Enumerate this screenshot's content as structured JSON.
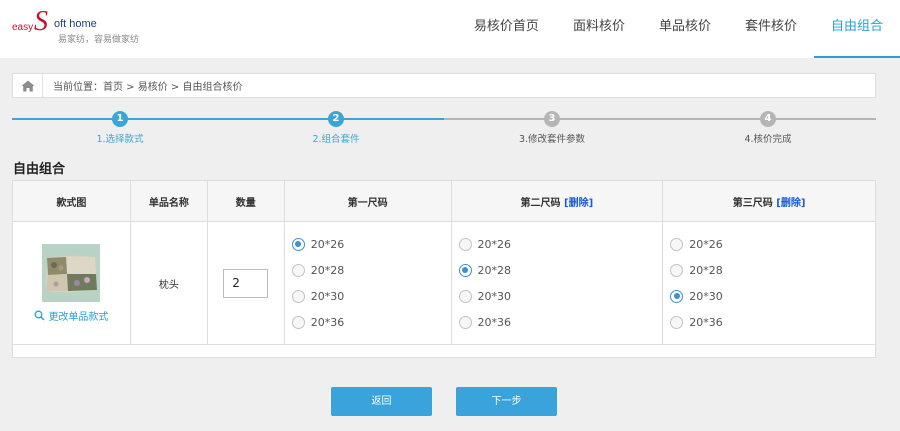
{
  "header": {
    "logo": {
      "easy": "easy",
      "s_letter": "S",
      "rest": "oft home",
      "slogan": "易家纺，容易做家纺"
    },
    "nav": [
      {
        "label": "易核价首页",
        "name": "nav-home"
      },
      {
        "label": "面料核价",
        "name": "nav-fabric-pricing"
      },
      {
        "label": "单品核价",
        "name": "nav-single-pricing"
      },
      {
        "label": "套件核价",
        "name": "nav-set-pricing"
      },
      {
        "label": "自由组合",
        "name": "nav-free-combination"
      }
    ],
    "active_nav": 4,
    "accent_color": "#2a9fd6"
  },
  "breadcrumb": {
    "icon": "home-icon",
    "text": "当前位置：首页 > 易核价 > 自由组合核价"
  },
  "steps": [
    {
      "num": "1",
      "label": "1.选择款式",
      "done": true
    },
    {
      "num": "2",
      "label": "2.组合套件",
      "done": true
    },
    {
      "num": "3",
      "label": "3.修改套件参数",
      "done": false
    },
    {
      "num": "4",
      "label": "4.核价完成",
      "done": false
    }
  ],
  "section_title": "自由组合",
  "table": {
    "headers": {
      "image": "款式图",
      "name": "单品名称",
      "qty": "数量",
      "size1": "第一尺码",
      "size2": "第二尺码",
      "size3": "第三尺码",
      "delete": "[删除]"
    },
    "row": {
      "change_link": "更改单品款式",
      "name": "枕头",
      "qty": "2",
      "size_options": [
        "20*26",
        "20*28",
        "20*30",
        "20*36"
      ],
      "selected": [
        0,
        1,
        2
      ]
    }
  },
  "buttons": {
    "back": "返回",
    "next": "下一步"
  }
}
